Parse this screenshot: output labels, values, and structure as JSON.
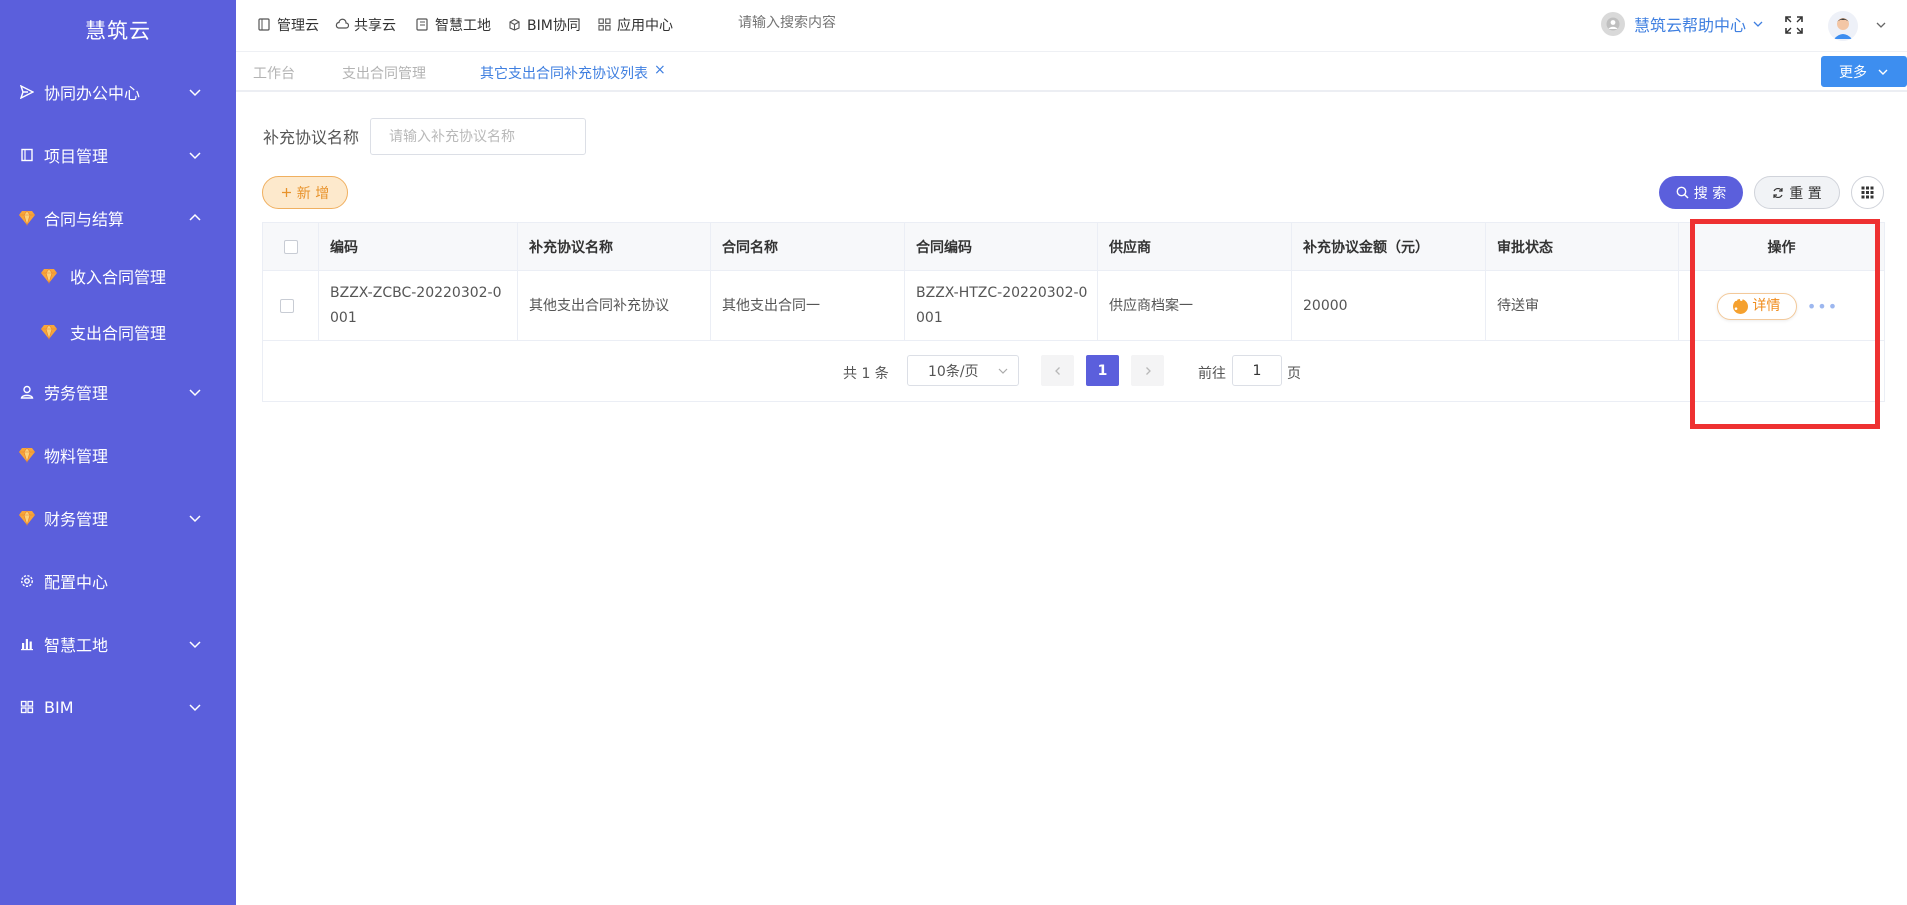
{
  "app": {
    "logo": "慧筑云"
  },
  "sidebar": {
    "items": [
      {
        "label": "协同办公中心"
      },
      {
        "label": "项目管理"
      },
      {
        "label": "合同与结算"
      },
      {
        "label": "收入合同管理"
      },
      {
        "label": "支出合同管理"
      },
      {
        "label": "劳务管理"
      },
      {
        "label": "物料管理"
      },
      {
        "label": "财务管理"
      },
      {
        "label": "配置中心"
      },
      {
        "label": "智慧工地"
      },
      {
        "label": "BIM"
      }
    ]
  },
  "topbar": {
    "nav": [
      {
        "label": "管理云"
      },
      {
        "label": "共享云"
      },
      {
        "label": "智慧工地"
      },
      {
        "label": "BIM协同"
      },
      {
        "label": "应用中心"
      }
    ],
    "search_placeholder": "请输入搜索内容",
    "help_label": "慧筑云帮助中心"
  },
  "tabs": {
    "items": [
      {
        "label": "工作台"
      },
      {
        "label": "支出合同管理"
      },
      {
        "label": "其它支出合同补充协议列表"
      }
    ],
    "close_glyph": "×",
    "more_label": "更多"
  },
  "filter": {
    "label": "补充协议名称",
    "placeholder": "请输入补充协议名称",
    "value": ""
  },
  "toolbar": {
    "add_label": "新 增",
    "search_label": "搜 索",
    "reset_label": "重 置"
  },
  "table": {
    "columns": [
      "编码",
      "补充协议名称",
      "合同名称",
      "合同编码",
      "供应商",
      "补充协议金额（元）",
      "审批状态",
      "操作"
    ],
    "rows": [
      {
        "code": "BZZX-ZCBC-20220302-0001",
        "name": "其他支出合同补充协议",
        "contract_name": "其他支出合同一",
        "contract_code": "BZZX-HTZC-20220302-0001",
        "supplier": "供应商档案一",
        "amount": "20000",
        "status": "待送审",
        "detail_label": "详情",
        "more_label": "•••"
      }
    ]
  },
  "pagination": {
    "total_text": "共 1 条",
    "page_size": "10条/页",
    "current_page": "1",
    "goto_label": "前往",
    "goto_value": "1",
    "page_suffix": "页"
  },
  "colors": {
    "sidebar_bg": "#5b5fdc",
    "accent_blue": "#3f7fe0",
    "primary": "#5b5fdc",
    "warning": "#f08c1c",
    "highlight": "#ee3131"
  }
}
